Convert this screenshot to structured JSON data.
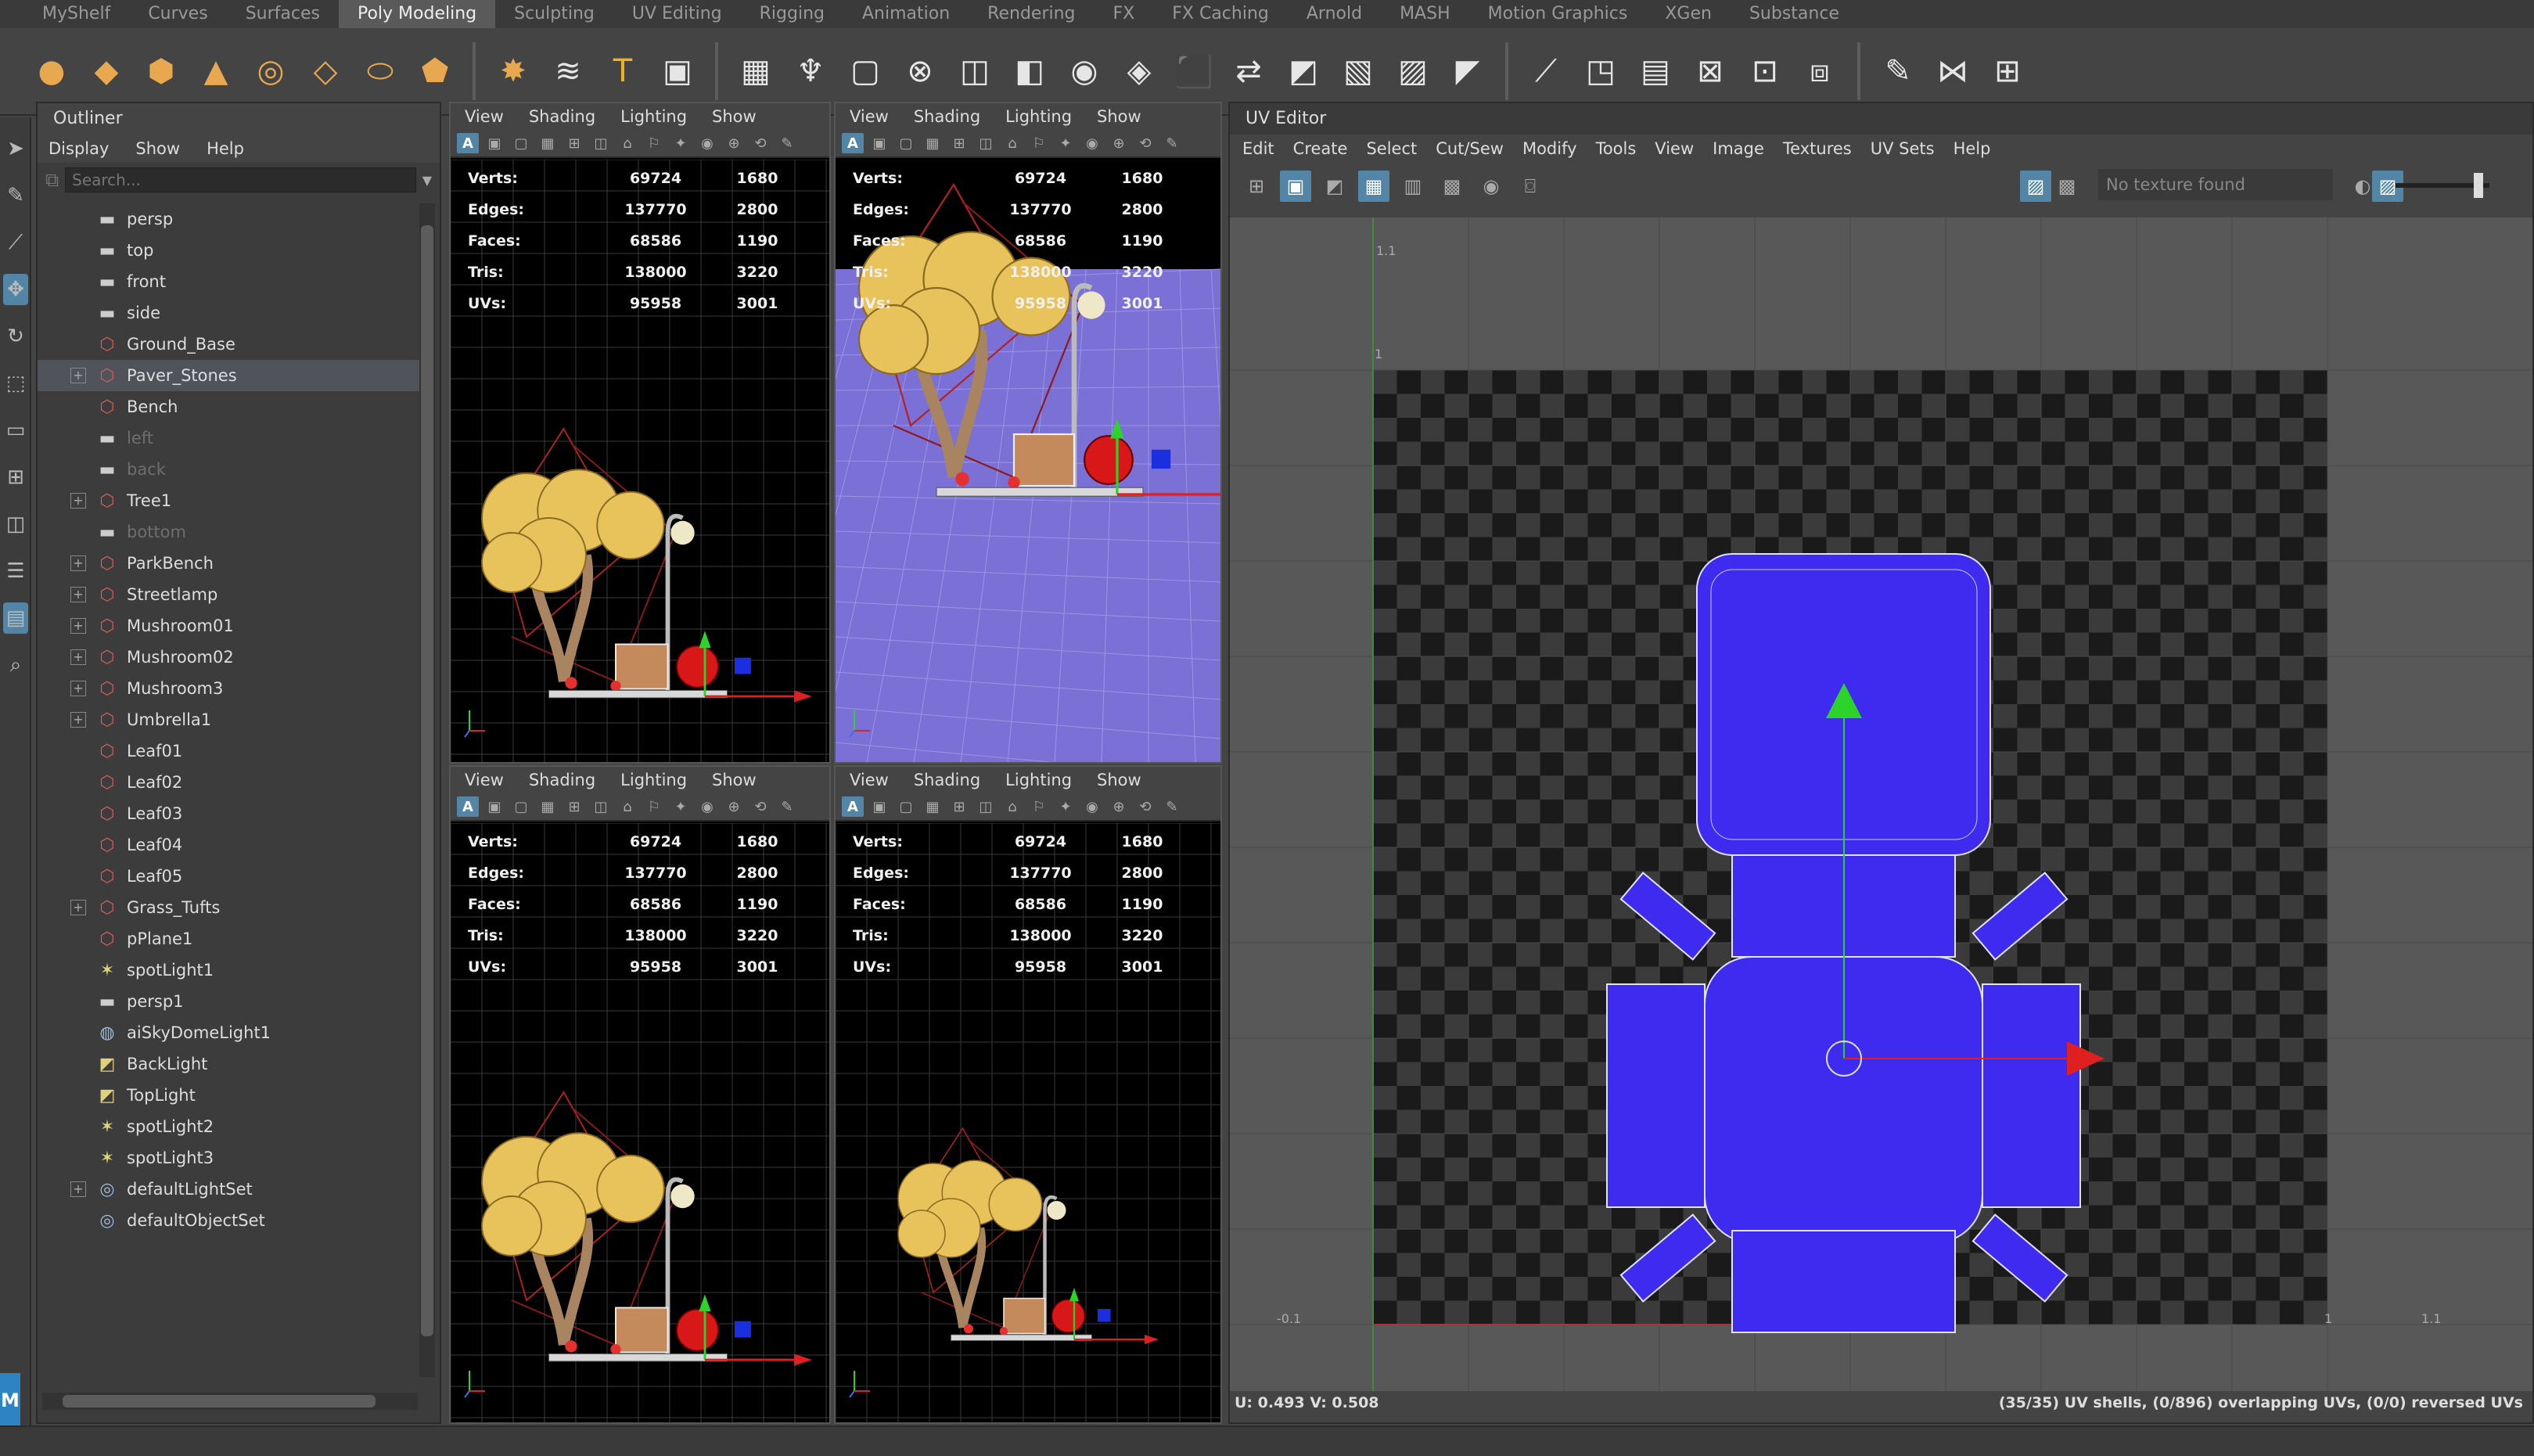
{
  "shelf_tabs": [
    "MyShelf",
    "Curves",
    "Surfaces",
    "Poly Modeling",
    "Sculpting",
    "UV Editing",
    "Rigging",
    "Animation",
    "Rendering",
    "FX",
    "FX Caching",
    "Arnold",
    "MASH",
    "Motion Graphics",
    "XGen",
    "Substance"
  ],
  "shelf_active_tab": "Poly Modeling",
  "shelf_icons": [
    "sphere-icon",
    "cube-icon",
    "cylinder-icon",
    "cone-icon",
    "torus-icon",
    "plane-icon",
    "disk-icon",
    "platonic-icon",
    "super-shape-icon",
    "sweep-mesh-icon",
    "type-icon",
    "svg-icon",
    "grid-icon",
    "mirror-icon",
    "bevel-icon",
    "uv-icon",
    "combine-icon",
    "separate-icon",
    "smooth-icon",
    "boolean-icon",
    "extrude-icon",
    "bridge-icon",
    "append-icon",
    "fill-hole-icon",
    "multi-cut-icon",
    "target-weld-icon",
    "connect-icon",
    "collapse-icon",
    "slide-edge-icon",
    "flip-icon",
    "symmetrize-icon",
    "average-icon",
    "paint-icon",
    "mirror-y-icon",
    "edge-loop-icon"
  ],
  "outliner": {
    "title": "Outliner",
    "menu": [
      "Display",
      "Show",
      "Help"
    ],
    "search_placeholder": "Search...",
    "items": [
      {
        "label": "persp",
        "icon": "camera-icon",
        "expandable": false,
        "selected": false,
        "dim": false
      },
      {
        "label": "top",
        "icon": "camera-icon",
        "expandable": false,
        "selected": false,
        "dim": false
      },
      {
        "label": "front",
        "icon": "camera-icon",
        "expandable": false,
        "selected": false,
        "dim": false
      },
      {
        "label": "side",
        "icon": "camera-icon",
        "expandable": false,
        "selected": false,
        "dim": false
      },
      {
        "label": "Ground_Base",
        "icon": "mesh-icon",
        "expandable": false,
        "selected": false,
        "dim": false
      },
      {
        "label": "Paver_Stones",
        "icon": "mesh-icon",
        "expandable": true,
        "selected": true,
        "dim": false
      },
      {
        "label": "Bench",
        "icon": "mesh-icon",
        "expandable": false,
        "selected": false,
        "dim": false
      },
      {
        "label": "left",
        "icon": "camera-icon",
        "expandable": false,
        "selected": false,
        "dim": true
      },
      {
        "label": "back",
        "icon": "camera-icon",
        "expandable": false,
        "selected": false,
        "dim": true
      },
      {
        "label": "Tree1",
        "icon": "mesh-icon",
        "expandable": true,
        "selected": false,
        "dim": false
      },
      {
        "label": "bottom",
        "icon": "camera-icon",
        "expandable": false,
        "selected": false,
        "dim": true
      },
      {
        "label": "ParkBench",
        "icon": "mesh-icon",
        "expandable": true,
        "selected": false,
        "dim": false
      },
      {
        "label": "Streetlamp",
        "icon": "mesh-icon",
        "expandable": true,
        "selected": false,
        "dim": false
      },
      {
        "label": "Mushroom01",
        "icon": "mesh-icon",
        "expandable": true,
        "selected": false,
        "dim": false
      },
      {
        "label": "Mushroom02",
        "icon": "mesh-icon",
        "expandable": true,
        "selected": false,
        "dim": false
      },
      {
        "label": "Mushroom3",
        "icon": "mesh-icon",
        "expandable": true,
        "selected": false,
        "dim": false
      },
      {
        "label": "Umbrella1",
        "icon": "mesh-icon",
        "expandable": true,
        "selected": false,
        "dim": false
      },
      {
        "label": "Leaf01",
        "icon": "mesh-icon",
        "expandable": false,
        "selected": false,
        "dim": false
      },
      {
        "label": "Leaf02",
        "icon": "mesh-icon",
        "expandable": false,
        "selected": false,
        "dim": false
      },
      {
        "label": "Leaf03",
        "icon": "mesh-icon",
        "expandable": false,
        "selected": false,
        "dim": false
      },
      {
        "label": "Leaf04",
        "icon": "mesh-icon",
        "expandable": false,
        "selected": false,
        "dim": false
      },
      {
        "label": "Leaf05",
        "icon": "mesh-icon",
        "expandable": false,
        "selected": false,
        "dim": false
      },
      {
        "label": "Grass_Tufts",
        "icon": "mesh-icon",
        "expandable": true,
        "selected": false,
        "dim": false
      },
      {
        "label": "pPlane1",
        "icon": "mesh-icon",
        "expandable": false,
        "selected": false,
        "dim": false
      },
      {
        "label": "spotLight1",
        "icon": "spotlight-icon",
        "expandable": false,
        "selected": false,
        "dim": false
      },
      {
        "label": "persp1",
        "icon": "camera-icon",
        "expandable": false,
        "selected": false,
        "dim": false
      },
      {
        "label": "aiSkyDomeLight1",
        "icon": "skydome-icon",
        "expandable": false,
        "selected": false,
        "dim": false
      },
      {
        "label": "BackLight",
        "icon": "area-light-icon",
        "expandable": false,
        "selected": false,
        "dim": false
      },
      {
        "label": "TopLight",
        "icon": "area-light-icon",
        "expandable": false,
        "selected": false,
        "dim": false
      },
      {
        "label": "spotLight2",
        "icon": "spotlight-icon",
        "expandable": false,
        "selected": false,
        "dim": false
      },
      {
        "label": "spotLight3",
        "icon": "spotlight-icon",
        "expandable": false,
        "selected": false,
        "dim": false
      },
      {
        "label": "defaultLightSet",
        "icon": "set-icon",
        "expandable": true,
        "selected": false,
        "dim": false
      },
      {
        "label": "defaultObjectSet",
        "icon": "set-icon",
        "expandable": false,
        "selected": false,
        "dim": false
      }
    ]
  },
  "viewport_menu": [
    "View",
    "Shading",
    "Lighting",
    "Show"
  ],
  "hud": {
    "rows": [
      {
        "key": "Verts:",
        "value": "69724",
        "sel": "1680"
      },
      {
        "key": "Edges:",
        "value": "137770",
        "sel": "2800"
      },
      {
        "key": "Faces:",
        "value": "68586",
        "sel": "1190"
      },
      {
        "key": "Tris:",
        "value": "138000",
        "sel": "3220"
      },
      {
        "key": "UVs:",
        "value": "95958",
        "sel": "3001"
      }
    ]
  },
  "uv_editor": {
    "title": "UV Editor",
    "menu": [
      "Edit",
      "Create",
      "Select",
      "Cut/Sew",
      "Modify",
      "Tools",
      "View",
      "Image",
      "Textures",
      "UV Sets",
      "Help"
    ],
    "texture_placeholder": "No texture found",
    "tick_labels": {
      "top_left": "1.1",
      "top_axis": "1",
      "bottom_left": "-0.1",
      "bottom_right_1": "1",
      "bottom_right_2": "1.1",
      "corner": "-0.1"
    },
    "coords": "U:  0.493  V:  0.508",
    "shell_status": "(35/35) UV shells, (0/896) overlapping UVs, (0/0) reversed UVs",
    "colors": {
      "shell_fill": "#3f2bf0",
      "checker_dark": "#1a1a1a",
      "checker_light": "#3b3b3b"
    }
  }
}
